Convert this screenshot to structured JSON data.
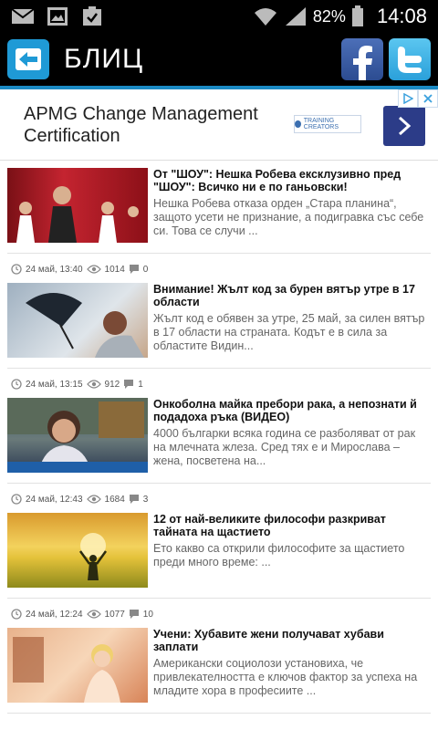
{
  "status_bar": {
    "battery": "82%",
    "time": "14:08"
  },
  "header": {
    "title": "БЛИЦ",
    "icons": [
      "back-arrow-icon",
      "facebook-icon",
      "twitter-icon"
    ]
  },
  "ad": {
    "text": "APMG Change Management Certification",
    "logo_text": "TRAINING CREATORS"
  },
  "articles": [
    {
      "title": "От \"ШОУ\": Нешка Робева ексклузивно пред \"ШОУ\": Всичко ни е по ганьовски!",
      "desc": "Нешка Робева отказа орден „Стара планина“, защото усети не признание, а подигравка със себе си. Това се случи ..."
    },
    {
      "time": "24 май, 13:40",
      "views": "1014",
      "comments": "0",
      "title": "Внимание! Жълт код за бурен вятър утре в 17 области",
      "desc": "Жълт код е обявен за утре, 25 май,  за силен вятър в 17 области на страната. Кодът е в сила за областите Видин..."
    },
    {
      "time": "24 май, 13:15",
      "views": "912",
      "comments": "1",
      "title": "Онкоболна майка пребори рака, а непознати й подадоха ръка (ВИДЕО)",
      "desc": "4000 българки всяка година се разболяват от рак на млечната жлеза. Сред тях е и Мирослава – жена, посветена на..."
    },
    {
      "time": "24 май, 12:43",
      "views": "1684",
      "comments": "3",
      "title": "12 от най-великите философи разкриват тайната на щастието",
      "desc": "Ето какво са открили философите за щастието преди много време: ..."
    },
    {
      "time": "24 май, 12:24",
      "views": "1077",
      "comments": "10",
      "title": "Учени: Хубавите жени получават хубави заплати",
      "desc": "Американски социолози установиха, че привлекателността е ключов фактор за успеха на младите хора в професиите ..."
    }
  ]
}
